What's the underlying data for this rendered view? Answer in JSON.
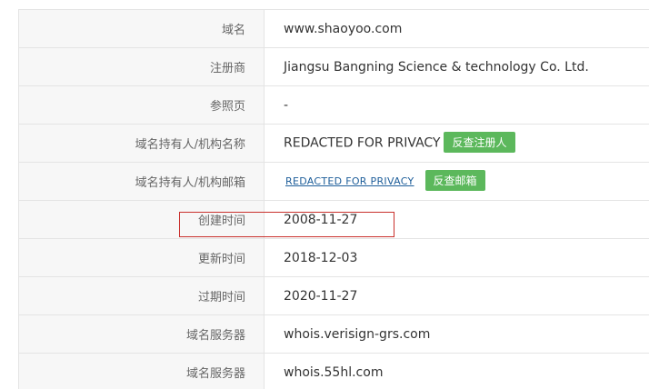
{
  "rows": [
    {
      "label": "域名",
      "value": "www.shaoyoo.com"
    },
    {
      "label": "注册商",
      "value": "Jiangsu Bangning Science & technology Co. Ltd."
    },
    {
      "label": "参照页",
      "value": "-"
    },
    {
      "label": "域名持有人/机构名称",
      "value": "REDACTED FOR PRIVACY",
      "button": "反查注册人"
    },
    {
      "label": "域名持有人/机构邮箱",
      "value": "REDACTED FOR PRIVACY",
      "button": "反查邮箱"
    },
    {
      "label": "创建时间",
      "value": "2008-11-27"
    },
    {
      "label": "更新时间",
      "value": "2018-12-03"
    },
    {
      "label": "过期时间",
      "value": "2020-11-27"
    },
    {
      "label": "域名服务器",
      "value": "whois.verisign-grs.com"
    },
    {
      "label": "域名服务器",
      "value": "whois.55hl.com"
    }
  ],
  "colors": {
    "button_bg": "#5cb85c",
    "link": "#1e5e9a",
    "highlight_border": "#c9302c",
    "label_bg": "#f7f7f7"
  }
}
